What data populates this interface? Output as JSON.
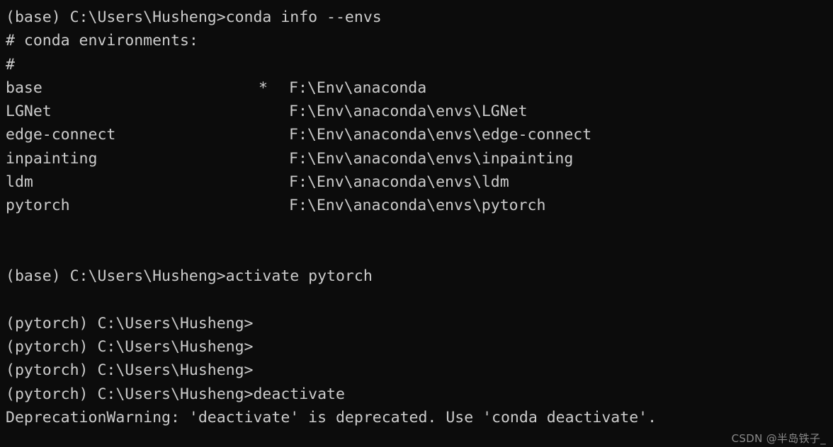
{
  "terminal": {
    "background_color": "#0c0c0c",
    "text_color": "#cccccc",
    "lines": [
      {
        "id": "prompt-conda-info",
        "text": "(base) C:\\Users\\Husheng>conda info --envs"
      },
      {
        "id": "comment-header",
        "text": "# conda environments:"
      },
      {
        "id": "comment-hash",
        "text": "#"
      }
    ],
    "env_list": {
      "active_marker": "*",
      "rows": [
        {
          "name": "base",
          "marker": "*",
          "path": "F:\\Env\\anaconda"
        },
        {
          "name": "LGNet",
          "marker": "",
          "path": "F:\\Env\\anaconda\\envs\\LGNet"
        },
        {
          "name": "edge-connect",
          "marker": "",
          "path": "F:\\Env\\anaconda\\envs\\edge-connect"
        },
        {
          "name": "inpainting",
          "marker": "",
          "path": "F:\\Env\\anaconda\\envs\\inpainting"
        },
        {
          "name": "ldm",
          "marker": "",
          "path": "F:\\Env\\anaconda\\envs\\ldm"
        },
        {
          "name": "pytorch",
          "marker": "",
          "path": "F:\\Env\\anaconda\\envs\\pytorch"
        }
      ]
    },
    "blank_1": "",
    "blank_2": "",
    "activate_command": "(base) C:\\Users\\Husheng>activate pytorch",
    "blank_3": "",
    "prompt_pytorch_1": "(pytorch) C:\\Users\\Husheng>",
    "prompt_pytorch_2": "(pytorch) C:\\Users\\Husheng>",
    "prompt_pytorch_3": "(pytorch) C:\\Users\\Husheng>",
    "deactivate_command": "(pytorch) C:\\Users\\Husheng>deactivate",
    "deprecation_warning": "DeprecationWarning: 'deactivate' is deprecated. Use 'conda deactivate'."
  },
  "watermark": {
    "text": "CSDN @半岛铁子_"
  }
}
